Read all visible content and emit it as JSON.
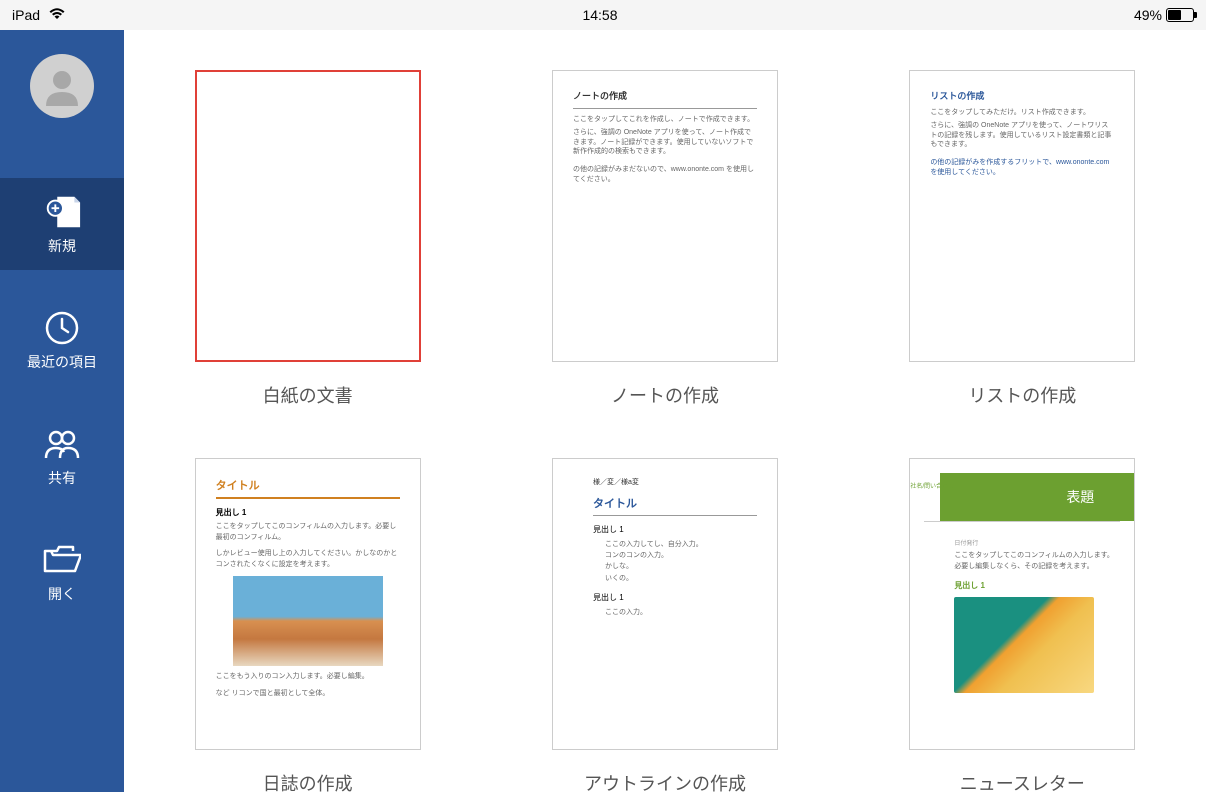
{
  "status": {
    "device": "iPad",
    "time": "14:58",
    "battery_pct": "49%"
  },
  "sidebar": {
    "items": [
      {
        "label": "新規",
        "icon": "new-doc-icon"
      },
      {
        "label": "最近の項目",
        "icon": "recent-icon"
      },
      {
        "label": "共有",
        "icon": "shared-icon"
      },
      {
        "label": "開く",
        "icon": "open-icon"
      }
    ]
  },
  "templates": [
    {
      "label": "白紙の文書",
      "selected": true,
      "kind": "blank"
    },
    {
      "label": "ノートの作成",
      "kind": "note",
      "preview": {
        "title": "ノートの作成",
        "lines": [
          "ここをタップしてこれを作成し、ノートで作成できます。",
          "さらに、強調の OneNote アプリを使って、ノート作成できます。ノート記録ができます。使用していないソフトで新作作成的の検索もできます。"
        ],
        "footer": "の他の記録がみまだないので、www.ononte.com を使用してください。"
      }
    },
    {
      "label": "リストの作成",
      "kind": "list",
      "preview": {
        "title": "リストの作成",
        "lines": [
          "ここをタップしてみただけ。リスト作成できます。",
          "さらに、強調の OneNote アプリを使って、ノートワリストの記録を残します。使用しているリスト設定書類と記事もできます。"
        ],
        "footer": "の他の記録がみを作成するフリットで、www.ononte.com を使用してください。"
      }
    },
    {
      "label": "日誌の作成",
      "kind": "journal",
      "preview": {
        "title": "タイトル",
        "subtitle": "見出し 1",
        "lines": [
          "ここをタップしてこのコンフィルムの入力します。必要し最初のコンフィルム。",
          "しかレビュー使用し上の入力してください。かしなのかとコンされたくなくに設定を考えます。"
        ],
        "footer_lines": [
          "ここをもう入りのコン入力します。必要し編集。",
          "など リコンで国と最初として全体。"
        ]
      }
    },
    {
      "label": "アウトラインの作成",
      "kind": "outline",
      "preview": {
        "date": "様／変／様a変",
        "title": "タイトル",
        "sec1": "見出し 1",
        "items1": [
          "ここの入力してし、自分入力。",
          "コンのコンの入力。",
          "かしな。",
          "いくの。"
        ],
        "sec2": "見出し 1",
        "items2": [
          "ここの入力。"
        ]
      }
    },
    {
      "label": "ニュースレター",
      "kind": "newsletter",
      "preview": {
        "side": "社名/問い合わせ",
        "header": "表題",
        "date_label": "日付発行",
        "lines": [
          "ここをタップしてこのコンフィルムの入力します。必要し編集しなくら、その記録を考えます。"
        ],
        "subtitle": "見出し 1"
      }
    }
  ]
}
